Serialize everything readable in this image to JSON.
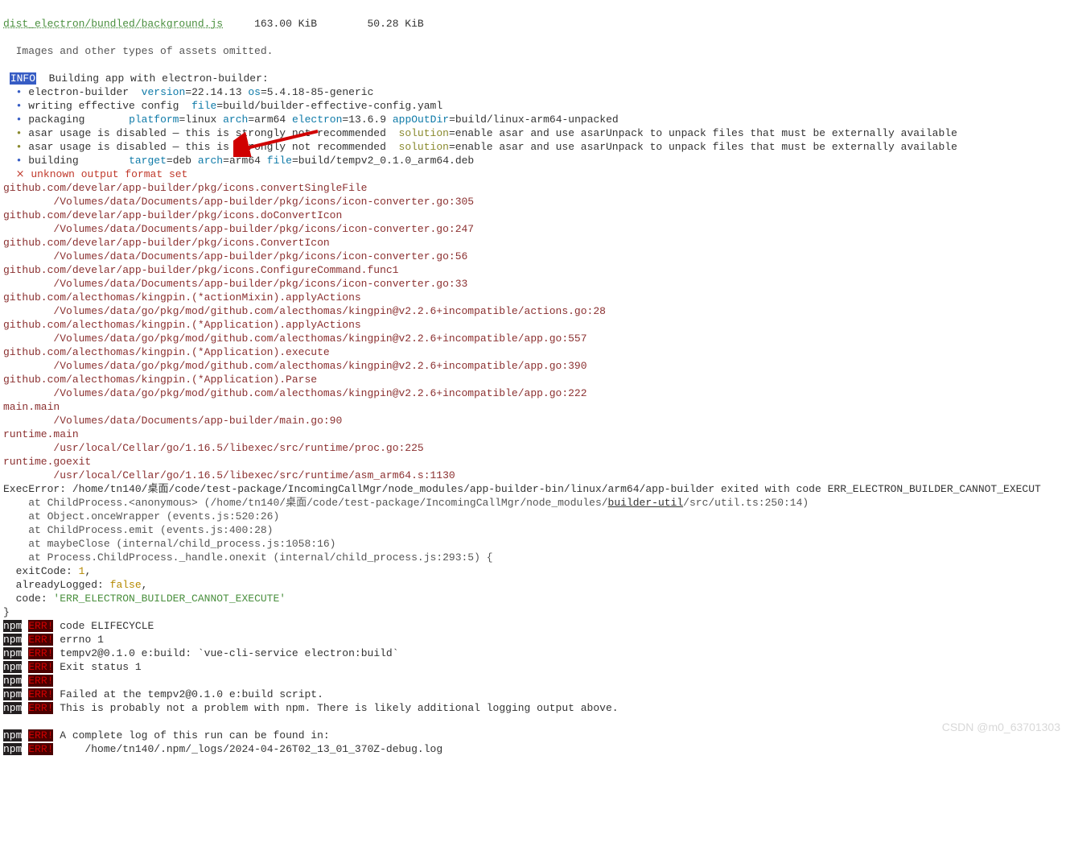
{
  "header": {
    "file": "dist_electron/bundled/background.js",
    "size": "163.00 KiB",
    "gzip": "50.28 KiB",
    "omitted": "Images and other types of assets omitted."
  },
  "build": {
    "info_label": "INFO",
    "start": "Building app with electron-builder:",
    "eb": {
      "k1": "version",
      "v1": "22.14.13",
      "k2": "os",
      "v2": "5.4.18-85-generic"
    },
    "cfg": {
      "k1": "file",
      "v1": "build/builder-effective-config.yaml"
    },
    "pkg": {
      "k1": "platform",
      "v1": "linux",
      "k2": "arch",
      "v2": "arm64",
      "k3": "electron",
      "v3": "13.6.9",
      "k4": "appOutDir",
      "v4": "build/linux-arm64-unpacked"
    },
    "asar1": {
      "msg": "asar usage is disabled — this is strongly not recommended",
      "k": "solution",
      "v": "enable asar and use asarUnpack to unpack files that must be externally available"
    },
    "asar2": {
      "msg": "asar usage is disabled — this is strongly not recommended",
      "k": "solution",
      "v": "enable asar and use asarUnpack to unpack files that must be externally available"
    },
    "deb": {
      "k1": "target",
      "v1": "deb",
      "k2": "arch",
      "v2": "arm64",
      "k3": "file",
      "v3": "build/tempv2_0.1.0_arm64.deb"
    }
  },
  "error": {
    "msg": "unknown output format set"
  },
  "stack": [
    "github.com/develar/app-builder/pkg/icons.convertSingleFile",
    "/Volumes/data/Documents/app-builder/pkg/icons/icon-converter.go:305",
    "github.com/develar/app-builder/pkg/icons.doConvertIcon",
    "/Volumes/data/Documents/app-builder/pkg/icons/icon-converter.go:247",
    "github.com/develar/app-builder/pkg/icons.ConvertIcon",
    "/Volumes/data/Documents/app-builder/pkg/icons/icon-converter.go:56",
    "github.com/develar/app-builder/pkg/icons.ConfigureCommand.func1",
    "/Volumes/data/Documents/app-builder/pkg/icons/icon-converter.go:33",
    "github.com/alecthomas/kingpin.(*actionMixin).applyActions",
    "/Volumes/data/go/pkg/mod/github.com/alecthomas/kingpin@v2.2.6+incompatible/actions.go:28",
    "github.com/alecthomas/kingpin.(*Application).applyActions",
    "/Volumes/data/go/pkg/mod/github.com/alecthomas/kingpin@v2.2.6+incompatible/app.go:557",
    "github.com/alecthomas/kingpin.(*Application).execute",
    "/Volumes/data/go/pkg/mod/github.com/alecthomas/kingpin@v2.2.6+incompatible/app.go:390",
    "github.com/alecthomas/kingpin.(*Application).Parse",
    "/Volumes/data/go/pkg/mod/github.com/alecthomas/kingpin@v2.2.6+incompatible/app.go:222",
    "main.main",
    "/Volumes/data/Documents/app-builder/main.go:90",
    "runtime.main",
    "/usr/local/Cellar/go/1.16.5/libexec/src/runtime/proc.go:225",
    "runtime.goexit",
    "/usr/local/Cellar/go/1.16.5/libexec/src/runtime/asm_arm64.s:1130"
  ],
  "exec": {
    "path": "/home/tn140/桌面/code/test-package/IncomingCallMgr/node_modules/app-builder-bin/linux/arm64/app-builder",
    "code": "ERR_ELECTRON_BUILDER_CANNOT_EXECUT",
    "at0a": "/home/tn140/桌面/code/test-package/IncomingCallMgr/node_modules/",
    "at0b": "builder-util",
    "at0c": "/src/util.ts:250:14",
    "at1": "at Object.onceWrapper (events.js:520:26)",
    "at2": "at ChildProcess.emit (events.js:400:28)",
    "at3": "at maybeClose (internal/child_process.js:1058:16)",
    "at4": "at Process.ChildProcess._handle.onexit (internal/child_process.js:293:5) {",
    "exitCode": "1",
    "alreadyLogged": "false",
    "codeStr": "'ERR_ELECTRON_BUILDER_CANNOT_EXECUTE'"
  },
  "npm": [
    {
      "k": "code",
      "v": "ELIFECYCLE"
    },
    {
      "k": "errno",
      "v": "1"
    },
    {
      "v": "tempv2@0.1.0 e:build: `vue-cli-service electron:build`"
    },
    {
      "v": "Exit status 1"
    },
    {
      "v": ""
    },
    {
      "v": "Failed at the tempv2@0.1.0 e:build script."
    },
    {
      "v": "This is probably not a problem with npm. There is likely additional logging output above."
    },
    {
      "v": "A complete log of this run can be found in:"
    },
    {
      "v": "/home/tn140/.npm/_logs/2024-04-26T02_13_01_370Z-debug.log"
    }
  ],
  "watermark": "CSDN @m0_63701303"
}
